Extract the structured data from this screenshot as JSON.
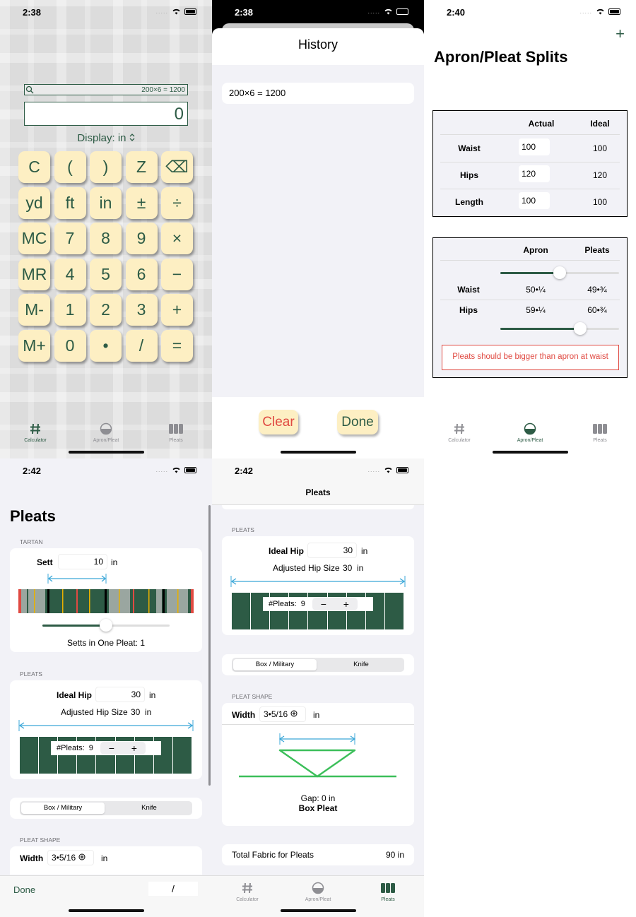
{
  "status": {
    "time_1": "2:38",
    "time_2": "2:38",
    "time_3": "2:40",
    "time_4": "2:42",
    "time_5": "2:42",
    "dots": "....."
  },
  "tabs": {
    "calculator": "Calculator",
    "apron": "Apron/Pleat",
    "pleats": "Pleats"
  },
  "calculator": {
    "history_value": "200×6 = 1200",
    "display_value": "0",
    "display_mode": "Display: in",
    "keys": [
      "C",
      "(",
      ")",
      "Z",
      "⌫",
      "yd",
      "ft",
      "in",
      "±",
      "÷",
      "MC",
      "7",
      "8",
      "9",
      "×",
      "MR",
      "4",
      "5",
      "6",
      "−",
      "M-",
      "1",
      "2",
      "3",
      "+",
      "M+",
      "0",
      "•",
      "/",
      "="
    ]
  },
  "history": {
    "title": "History",
    "items": [
      "200×6 = 1200"
    ],
    "clear_label": "Clear",
    "done_label": "Done"
  },
  "apron": {
    "title": "Apron/Pleat Splits",
    "add_icon": "+",
    "table1": {
      "col_actual": "Actual",
      "col_ideal": "Ideal",
      "rows": [
        {
          "label": "Waist",
          "actual": "100",
          "ideal": "100"
        },
        {
          "label": "Hips",
          "actual": "120",
          "ideal": "120"
        },
        {
          "label": "Length",
          "actual": "100",
          "ideal": "100"
        }
      ]
    },
    "table2": {
      "col_apron": "Apron",
      "col_pleats": "Pleats",
      "waist_slider": 0.5,
      "hips_slider": 0.67,
      "rows": [
        {
          "label": "Waist",
          "apron": "50•¼",
          "pleats": "49•¾"
        },
        {
          "label": "Hips",
          "apron": "59•¼",
          "pleats": "60•¾"
        }
      ]
    },
    "warning": "Pleats should be bigger than apron at waist"
  },
  "pleats_left": {
    "title": "Pleats",
    "tartan_section": "TARTAN",
    "sett_label": "Sett",
    "sett_value": "10",
    "unit": "in",
    "sett_slider": 0.5,
    "setts_in_pleat": "Setts in One Pleat: 1",
    "pleats_section": "PLEATS",
    "ideal_hip_label": "Ideal Hip",
    "ideal_hip_value": "30",
    "adjusted_hip": "Adjusted Hip Size",
    "adjusted_hip_value": "30",
    "num_pleats_label": "#Pleats:",
    "num_pleats_value": "9",
    "minus": "−",
    "plus": "+",
    "seg_box": "Box / Military",
    "seg_knife": "Knife",
    "shape_section": "PLEAT SHAPE",
    "width_label": "Width",
    "width_value": "3•5/16",
    "done_label": "Done",
    "slash_label": "/"
  },
  "pleats_right": {
    "nav_title": "Pleats",
    "pleats_section": "PLEATS",
    "ideal_hip_label": "Ideal Hip",
    "ideal_hip_value": "30",
    "unit": "in",
    "adjusted_hip": "Adjusted Hip Size",
    "adjusted_hip_value": "30",
    "num_pleats_label": "#Pleats:",
    "num_pleats_value": "9",
    "minus": "−",
    "plus": "+",
    "seg_box": "Box / Military",
    "seg_knife": "Knife",
    "shape_section": "PLEAT SHAPE",
    "width_label": "Width",
    "width_value": "3•5/16",
    "gap": "Gap: 0 in",
    "pleat_type": "Box Pleat",
    "total_label": "Total Fabric for Pleats",
    "total_value": "90 in"
  },
  "colors": {
    "accent": "#2d5b45",
    "key_bg": "#fdefc3",
    "warning": "#e04a42",
    "arrow": "#3ba7d8",
    "pleat_line": "#3cbf5a"
  }
}
